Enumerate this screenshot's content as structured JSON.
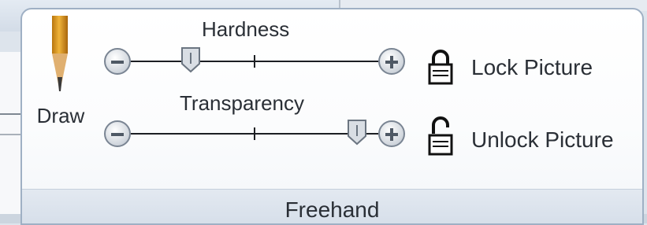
{
  "ribbon_group": {
    "label": "Freehand",
    "draw_button": {
      "label": "Draw",
      "icon": "pencil-icon"
    },
    "hardness": {
      "title": "Hardness",
      "decrease_icon": "minus-circle-icon",
      "increase_icon": "plus-circle-icon",
      "value_fraction": 0.22
    },
    "transparency": {
      "title": "Transparency",
      "decrease_icon": "minus-circle-icon",
      "increase_icon": "plus-circle-icon",
      "value_fraction": 0.95
    },
    "lock_picture": {
      "label": "Lock Picture",
      "icon": "locked-padlock-icon"
    },
    "unlock_picture": {
      "label": "Unlock Picture",
      "icon": "unlocked-padlock-icon"
    }
  },
  "colors": {
    "group_border": "#9fb0c4",
    "text": "#2a2f36",
    "pencil_body": "#d99a1d",
    "pencil_lead": "#3a3a3a"
  }
}
